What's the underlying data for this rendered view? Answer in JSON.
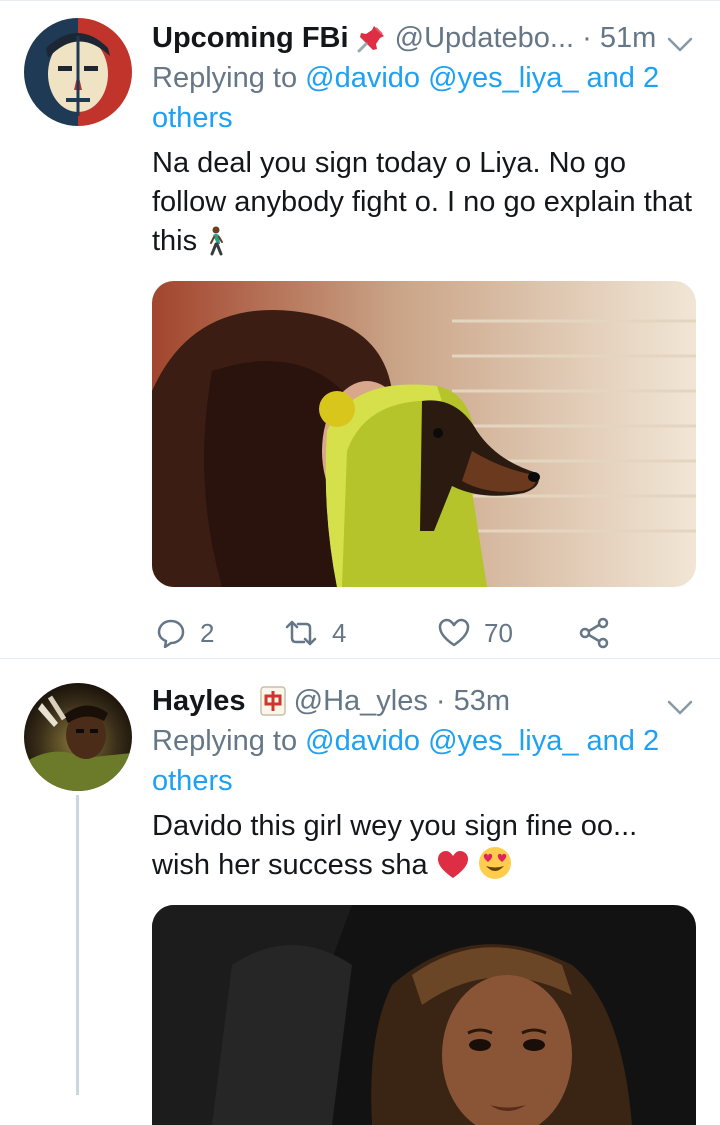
{
  "tweets": [
    {
      "name": "Upcoming FBi",
      "name_emoji": "pushpin-icon",
      "handle": "@Updatebo...",
      "separator": "·",
      "time": "51m",
      "reply_prefix": "Replying to",
      "reply_mentions": "@davido @yes_liya_ and 2 others",
      "text": "Na deal you sign today o Liya. No go follow anybody fight o. I no go explain that this",
      "text_emoji": "person-walking-icon",
      "media": "woman-with-dog-in-yellow-hood-photo",
      "replies": "2",
      "retweets": "4",
      "likes": "70"
    },
    {
      "name": "Hayles",
      "name_emoji": "mahjong-tile-icon",
      "handle": "@Ha_yles",
      "separator": "·",
      "time": "53m",
      "reply_prefix": "Replying to",
      "reply_mentions": "@davido @yes_liya_ and 2 others",
      "text": "Davido this girl wey you sign fine oo... wish her success sha",
      "text_emoji": "red-heart-and-heart-eyes-icons",
      "media": "woman-portrait-dark-photo"
    }
  ],
  "colors": {
    "link": "#1da1f2",
    "secondary": "#657786",
    "divider": "#e6ecf0",
    "thread_line": "#ccd6dd"
  }
}
